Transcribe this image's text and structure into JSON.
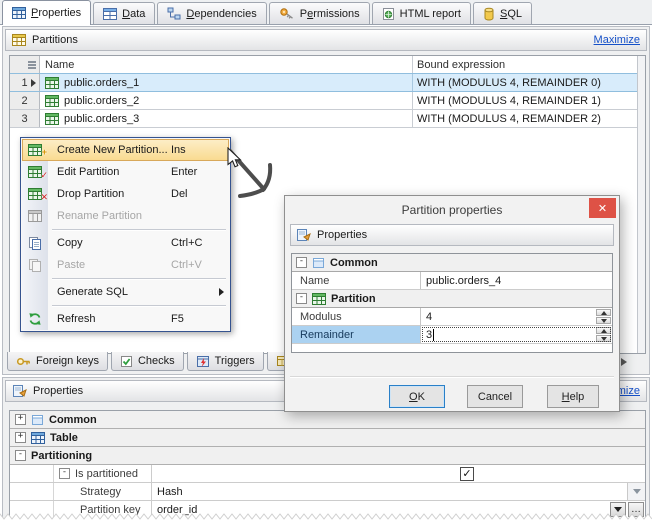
{
  "icons": {
    "close_glyph": "✕",
    "ellipsis_glyph": "…",
    "check_glyph": "✓"
  },
  "colors": {
    "selection_blue": "#d8ecfb",
    "menu_highlight": "#f9da8e",
    "close_red": "#de5246",
    "link_blue": "#1550c8",
    "selected_label_blue": "#abd2f1"
  },
  "top_tabs": [
    {
      "label": "Properties",
      "accel": "P",
      "icon": "properties-tab-icon",
      "active": true
    },
    {
      "label": "Data",
      "accel": "D",
      "icon": "data-tab-icon",
      "active": false
    },
    {
      "label": "Dependencies",
      "accel": "D",
      "icon": "dependencies-tab-icon",
      "active": false
    },
    {
      "label": "Permissions",
      "accel": "e",
      "icon": "permissions-tab-icon",
      "active": false
    },
    {
      "label": "HTML report",
      "accel": "",
      "icon": "html-report-tab-icon",
      "active": false
    },
    {
      "label": "SQL",
      "accel": "S",
      "icon": "sql-tab-icon",
      "active": false
    }
  ],
  "partitions_panel": {
    "title": "Partitions",
    "maximize_label": "Maximize"
  },
  "partitions_table": {
    "columns": [
      "Name",
      "Bound expression"
    ],
    "rows": [
      {
        "num": "1",
        "name": "public.orders_1",
        "bound": "WITH (MODULUS 4, REMAINDER 0)",
        "selected": true,
        "current": true
      },
      {
        "num": "2",
        "name": "public.orders_2",
        "bound": "WITH (MODULUS 4, REMAINDER 1)",
        "selected": false,
        "current": false
      },
      {
        "num": "3",
        "name": "public.orders_3",
        "bound": "WITH (MODULUS 4, REMAINDER 2)",
        "selected": false,
        "current": false
      }
    ]
  },
  "context_menu": {
    "items": [
      {
        "label": "Create New Partition...",
        "shortcut": "Ins",
        "icon": "create-partition-icon",
        "highlighted": true,
        "disabled": false,
        "submenu": false
      },
      {
        "label": "Edit Partition",
        "shortcut": "Enter",
        "icon": "edit-partition-icon",
        "highlighted": false,
        "disabled": false,
        "submenu": false
      },
      {
        "label": "Drop Partition",
        "shortcut": "Del",
        "icon": "drop-partition-icon",
        "highlighted": false,
        "disabled": false,
        "submenu": false
      },
      {
        "label": "Rename Partition",
        "shortcut": "",
        "icon": "rename-partition-icon",
        "highlighted": false,
        "disabled": true,
        "submenu": false
      },
      {
        "separator": true
      },
      {
        "label": "Copy",
        "shortcut": "Ctrl+C",
        "icon": "copy-icon",
        "highlighted": false,
        "disabled": false,
        "submenu": false
      },
      {
        "label": "Paste",
        "shortcut": "Ctrl+V",
        "icon": "paste-icon",
        "highlighted": false,
        "disabled": true,
        "submenu": false
      },
      {
        "separator": true
      },
      {
        "label": "Generate SQL",
        "shortcut": "",
        "icon": "",
        "highlighted": false,
        "disabled": false,
        "submenu": true
      },
      {
        "separator": true
      },
      {
        "label": "Refresh",
        "shortcut": "F5",
        "icon": "refresh-icon",
        "highlighted": false,
        "disabled": false,
        "submenu": false
      }
    ]
  },
  "dialog": {
    "title": "Partition properties",
    "header": "Properties",
    "grid": [
      {
        "type": "group",
        "label": "Common",
        "expand": "-",
        "icon": "common-group-icon"
      },
      {
        "type": "row",
        "label": "Name",
        "value": "public.orders_4",
        "spinner": false,
        "selected": false,
        "editing": false
      },
      {
        "type": "group",
        "label": "Partition",
        "expand": "-",
        "icon": "partition-group-icon"
      },
      {
        "type": "row",
        "label": "Modulus",
        "value": "4",
        "spinner": true,
        "selected": false,
        "editing": false
      },
      {
        "type": "row",
        "label": "Remainder",
        "value": "3",
        "spinner": true,
        "selected": true,
        "editing": true
      }
    ],
    "buttons": [
      {
        "label": "OK",
        "accel": "O",
        "focused": true
      },
      {
        "label": "Cancel",
        "accel": "",
        "focused": false
      },
      {
        "label": "Help",
        "accel": "H",
        "focused": false
      }
    ]
  },
  "bottom_tabs": [
    {
      "label": "Foreign keys",
      "icon": "foreign-keys-icon",
      "partial": false
    },
    {
      "label": "Checks",
      "icon": "checks-icon",
      "partial": false
    },
    {
      "label": "Triggers",
      "icon": "triggers-icon",
      "partial": false
    },
    {
      "label": "",
      "icon": "indices-icon",
      "partial": true
    }
  ],
  "bottom_panel": {
    "title": "Properties",
    "maximize_label": "Maximize"
  },
  "bottom_grid": {
    "rows": [
      {
        "type": "group",
        "label": "Common",
        "expand": "+",
        "icon": "common-group-icon"
      },
      {
        "type": "group",
        "label": "Table",
        "expand": "+",
        "icon": "table-group-icon"
      },
      {
        "type": "group",
        "label": "Partitioning",
        "expand": "-",
        "icon": ""
      },
      {
        "type": "check",
        "label": "Is partitioned",
        "expand": "-",
        "checked": true
      },
      {
        "type": "prop",
        "label": "Strategy",
        "value": "Hash",
        "control": "flat-dropdown"
      },
      {
        "type": "prop",
        "label": "Partition key",
        "value": "order_id",
        "control": "dropdown-ellipsis"
      }
    ]
  }
}
